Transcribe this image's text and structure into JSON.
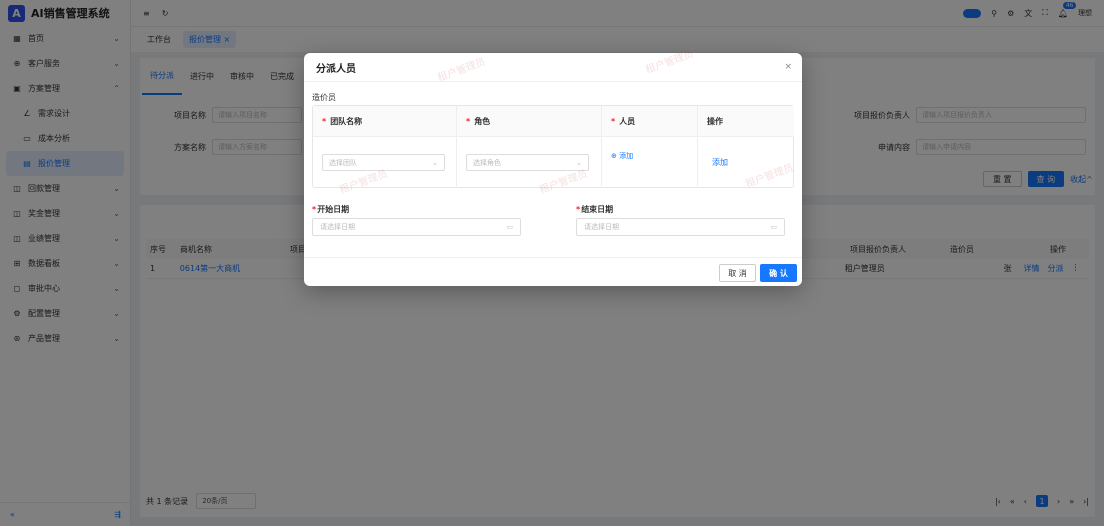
{
  "app": {
    "logo_letter": "A",
    "title": "AI销售管理系统"
  },
  "sidebar": {
    "items": [
      {
        "icon": "grid-icon",
        "glyph": "▦",
        "label": "首页",
        "arrow": "⌄"
      },
      {
        "icon": "customer-service-icon",
        "glyph": "⊕",
        "label": "客户服务",
        "arrow": "⌄"
      },
      {
        "icon": "plan-icon",
        "glyph": "▣",
        "label": "方案管理",
        "arrow": "⌃"
      },
      {
        "icon": "edit-icon",
        "glyph": "∠",
        "label": "需求设计",
        "sub": true
      },
      {
        "icon": "chart-icon",
        "glyph": "▭",
        "label": "成本分析",
        "sub": true
      },
      {
        "icon": "quote-icon",
        "glyph": "▤",
        "label": "报价管理",
        "sub": true,
        "active": true
      },
      {
        "icon": "payment-icon",
        "glyph": "◫",
        "label": "回款管理",
        "arrow": "⌄"
      },
      {
        "icon": "bonus-icon",
        "glyph": "◫",
        "label": "奖金管理",
        "arrow": "⌄"
      },
      {
        "icon": "performance-icon",
        "glyph": "◫",
        "label": "业绩管理",
        "arrow": "⌄"
      },
      {
        "icon": "dashboard-icon",
        "glyph": "⊞",
        "label": "数据看板",
        "arrow": "⌄"
      },
      {
        "icon": "approval-icon",
        "glyph": "◻",
        "label": "审批中心",
        "arrow": "⌄"
      },
      {
        "icon": "settings-icon",
        "glyph": "⚙",
        "label": "配置管理",
        "arrow": "⌄"
      },
      {
        "icon": "product-icon",
        "glyph": "⊛",
        "label": "产品管理",
        "arrow": "⌄"
      }
    ],
    "collapse_glyph": "«",
    "bottom_glyph": "⇶"
  },
  "header": {
    "menu_glyph": "≡",
    "refresh_glyph": "↻",
    "notification_count": "46",
    "user": "理想"
  },
  "tabs": [
    {
      "label": "工作台"
    },
    {
      "label": "报价管理",
      "active": true,
      "close": "×"
    }
  ],
  "subtabs": [
    {
      "label": "待分派",
      "active": true
    },
    {
      "label": "进行中"
    },
    {
      "label": "审核中"
    },
    {
      "label": "已完成"
    }
  ],
  "filters": {
    "project_name": {
      "label": "项目名称",
      "placeholder": "请输入项目名称"
    },
    "plan_name": {
      "label": "方案名称",
      "placeholder": "请输入方案名称"
    },
    "owner": {
      "label": "项目报价负责人",
      "placeholder": "请输入项目报价负责人"
    },
    "apply": {
      "label": "申请内容",
      "placeholder": "请输入申请内容"
    },
    "reset_label": "重 置",
    "query_label": "查 询",
    "collapse_label": "收起^"
  },
  "table": {
    "columns": [
      "序号",
      "商机名称",
      "项目",
      "项目报价负责人",
      "造价员",
      "操作"
    ],
    "rows": [
      {
        "index": "1",
        "name": "0614第一大商机",
        "owner": "租户管理员",
        "cost": "张",
        "detail": "详情",
        "assign": "分派",
        "more": "⋮"
      }
    ]
  },
  "pager": {
    "total": "共 1 条记录",
    "page_size": "20条/页",
    "current": "1"
  },
  "modal": {
    "title": "分派人员",
    "close": "×",
    "section": "造价员",
    "columns": {
      "team": "团队名称",
      "role": "角色",
      "person": "人员",
      "op": "操作"
    },
    "team_placeholder": "选择团队",
    "role_placeholder": "选择角色",
    "add_person": "添加",
    "add_row": "添加",
    "start_label": "开始日期",
    "end_label": "结束日期",
    "start_placeholder": "请选择日期",
    "end_placeholder": "请选择日期",
    "cancel": "取 消",
    "confirm": "确 认"
  },
  "watermark": "租户管理员",
  "colors": {
    "primary": "#1677ff",
    "required": "#f5222d"
  }
}
